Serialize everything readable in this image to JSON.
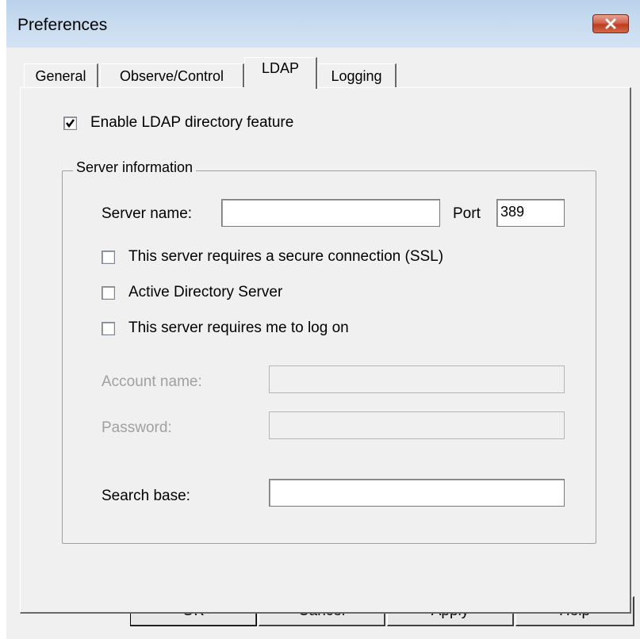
{
  "window": {
    "title": "Preferences"
  },
  "tabs": [
    {
      "label": "General",
      "active": false
    },
    {
      "label": "Observe/Control",
      "active": false
    },
    {
      "label": "LDAP",
      "active": true
    },
    {
      "label": "Logging",
      "active": false
    }
  ],
  "ldap": {
    "enable_label": "Enable LDAP directory feature",
    "enable_checked": true,
    "group_title": "Server information",
    "server_name_label": "Server name:",
    "server_name_value": "",
    "port_label": "Port",
    "port_value": "389",
    "ssl_label": "This server requires a secure connection (SSL)",
    "ssl_checked": false,
    "ad_label": "Active Directory Server",
    "ad_checked": false,
    "logon_label": "This server requires me to log on",
    "logon_checked": false,
    "account_label": "Account name:",
    "account_value": "",
    "password_label": "Password:",
    "password_value": "",
    "search_base_label": "Search base:",
    "search_base_value": ""
  },
  "buttons": {
    "ok": "OK",
    "cancel": "Cancel",
    "apply": "Apply",
    "help": "Help"
  },
  "colors": {
    "title_bar": "#b9d1ea",
    "dialog_bg": "#f0f0f0",
    "close_button": "#c13b1f",
    "disabled_text": "#a0a0a0"
  }
}
